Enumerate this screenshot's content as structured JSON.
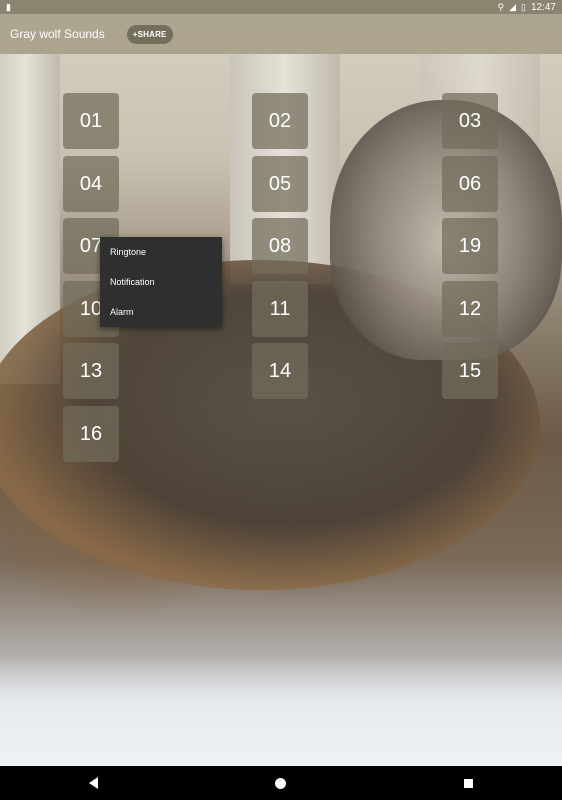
{
  "status_bar": {
    "left_icon": "sim-card-icon",
    "time": "12:47",
    "icons": [
      "location-pin-icon",
      "lte-signal-icon",
      "battery-icon"
    ]
  },
  "app_bar": {
    "title": "Gray wolf Sounds",
    "share_label": "+SHARE"
  },
  "sound_buttons": [
    "01",
    "02",
    "03",
    "04",
    "05",
    "06",
    "07",
    "08",
    "19",
    "10",
    "11",
    "12",
    "13",
    "14",
    "15",
    "16"
  ],
  "context_menu": {
    "items": [
      "Ringtone",
      "Notification",
      "Alarm"
    ]
  },
  "nav_bar": {
    "icons": [
      "back-icon",
      "home-icon",
      "recents-icon"
    ]
  }
}
